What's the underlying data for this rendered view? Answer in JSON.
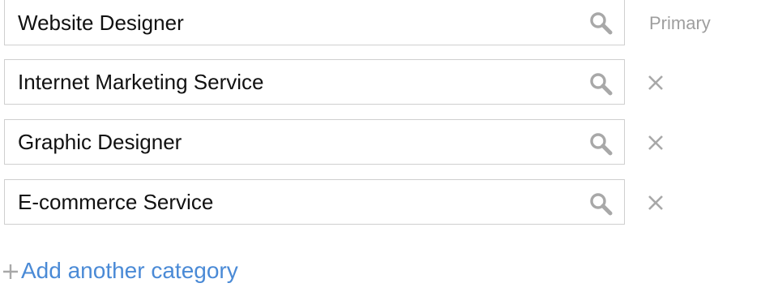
{
  "categories": [
    {
      "value": "Website Designer",
      "status": "Primary"
    },
    {
      "value": "Internet Marketing Service"
    },
    {
      "value": "Graphic Designer"
    },
    {
      "value": "E-commerce Service"
    }
  ],
  "add_link": {
    "label": "Add another category"
  },
  "icons": {
    "search": "search-icon",
    "remove": "close-icon",
    "add": "plus-icon"
  },
  "colors": {
    "link": "#4a8ad6",
    "muted": "#9e9e9e",
    "border": "#cfcfcf",
    "icon": "#a8a8a8"
  }
}
